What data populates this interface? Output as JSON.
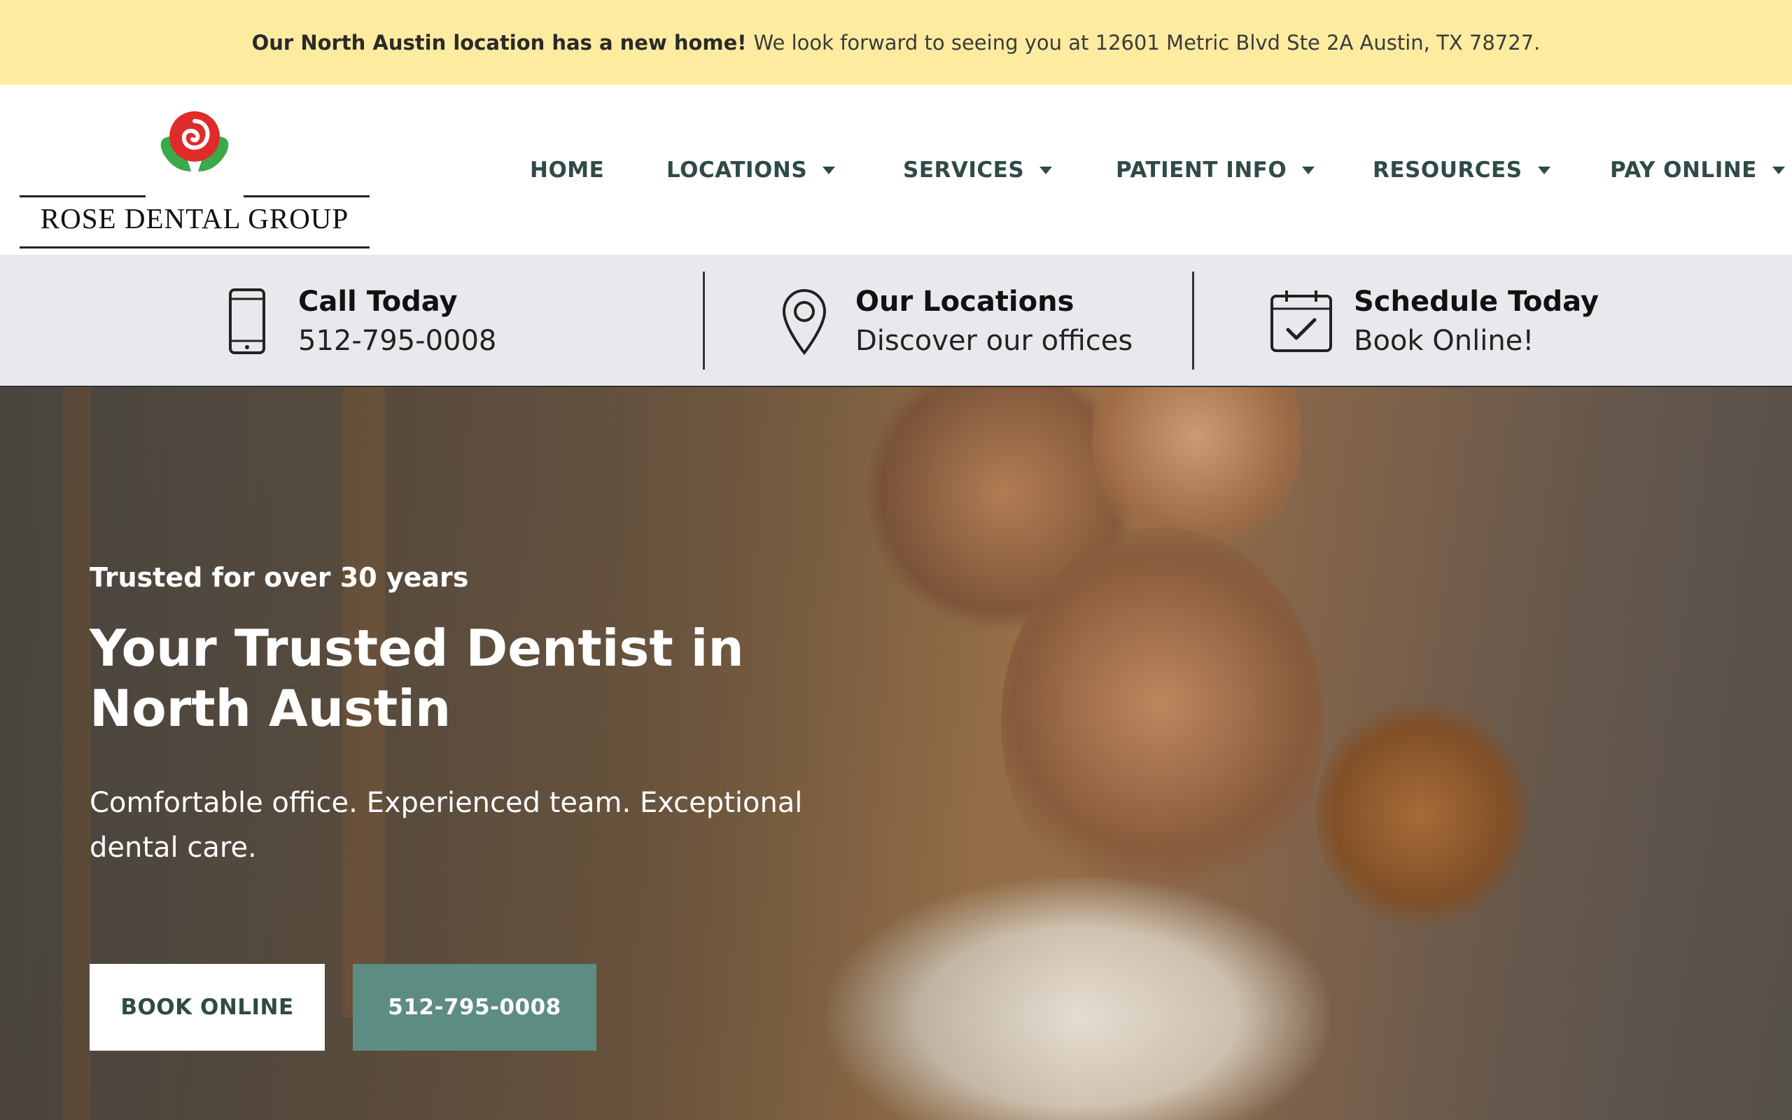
{
  "announcement": {
    "bold": "Our North Austin location has a new home!",
    "text": "We look forward to seeing you at 12601 Metric Blvd Ste 2A Austin, TX 78727."
  },
  "logo": {
    "brand": "ROSE DENTAL GROUP",
    "icon": "rose-icon",
    "colors": {
      "petal": "#e02b2b",
      "leaf": "#3aaa4a"
    }
  },
  "nav": {
    "items": [
      {
        "label": "HOME",
        "dropdown": false
      },
      {
        "label": "LOCATIONS",
        "dropdown": true
      },
      {
        "label": "SERVICES",
        "dropdown": true
      },
      {
        "label": "PATIENT INFO",
        "dropdown": true
      },
      {
        "label": "RESOURCES",
        "dropdown": true
      },
      {
        "label": "PAY ONLINE",
        "dropdown": true
      }
    ]
  },
  "info_bar": {
    "call": {
      "title": "Call Today",
      "sub": "512-795-0008",
      "icon": "phone-icon"
    },
    "locations": {
      "title": "Our Locations",
      "sub": "Discover our offices",
      "icon": "map-pin-icon"
    },
    "schedule": {
      "title": "Schedule Today",
      "sub": "Book Online!",
      "icon": "calendar-check-icon"
    }
  },
  "hero": {
    "eyebrow": "Trusted for over 30 years",
    "headline_line1": "Your Trusted Dentist in",
    "headline_line2": "North Austin",
    "lead": "Comfortable office. Experienced team. Exceptional dental care.",
    "book_button": "BOOK ONLINE",
    "phone_button": "512-795-0008"
  },
  "colors": {
    "announcement_bg": "#fdeba0",
    "nav_text": "#2f4a47",
    "info_bg": "#e8e9ec",
    "accent_button": "#5d8c83"
  }
}
